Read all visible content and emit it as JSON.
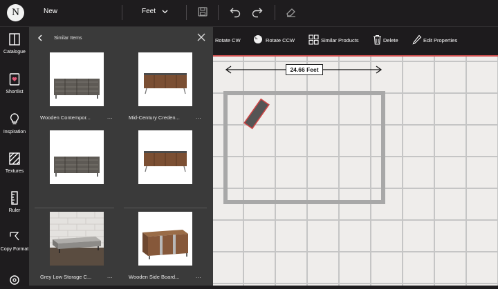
{
  "header": {
    "logo_letter": "N",
    "new_label": "New",
    "unit": "Feet"
  },
  "rail": {
    "items": [
      {
        "label": "Catalogue",
        "icon": "catalogue-icon"
      },
      {
        "label": "Shortlist",
        "icon": "shortlist-heart-icon"
      },
      {
        "label": "Inspiration",
        "icon": "lightbulb-icon"
      },
      {
        "label": "Textures",
        "icon": "textures-icon"
      },
      {
        "label": "Ruler",
        "icon": "ruler-icon"
      },
      {
        "label": "Copy Format",
        "icon": "copy-format-icon"
      }
    ]
  },
  "panel": {
    "title": "Similar Items",
    "items": [
      {
        "title": "Wooden Contempor...",
        "more": "..."
      },
      {
        "title": "Mid-Century Creden...",
        "more": "..."
      },
      {
        "title": "",
        "more": ""
      },
      {
        "title": "",
        "more": ""
      },
      {
        "title": "Grey Low Storage C...",
        "more": "..."
      },
      {
        "title": "Wooden Side Board...",
        "more": "..."
      }
    ]
  },
  "toolbar": {
    "rotate_cw": "Rotate CW",
    "rotate_ccw": "Rotate CCW",
    "similar_products": "Similar Products",
    "delete": "Delete",
    "edit_properties": "Edit Properties"
  },
  "canvas": {
    "dimension_label": "24.66 Feet"
  },
  "colors": {
    "accent_line": "#d05050",
    "grid": "#c5c5c5",
    "canvas_bg": "#efedeb"
  }
}
